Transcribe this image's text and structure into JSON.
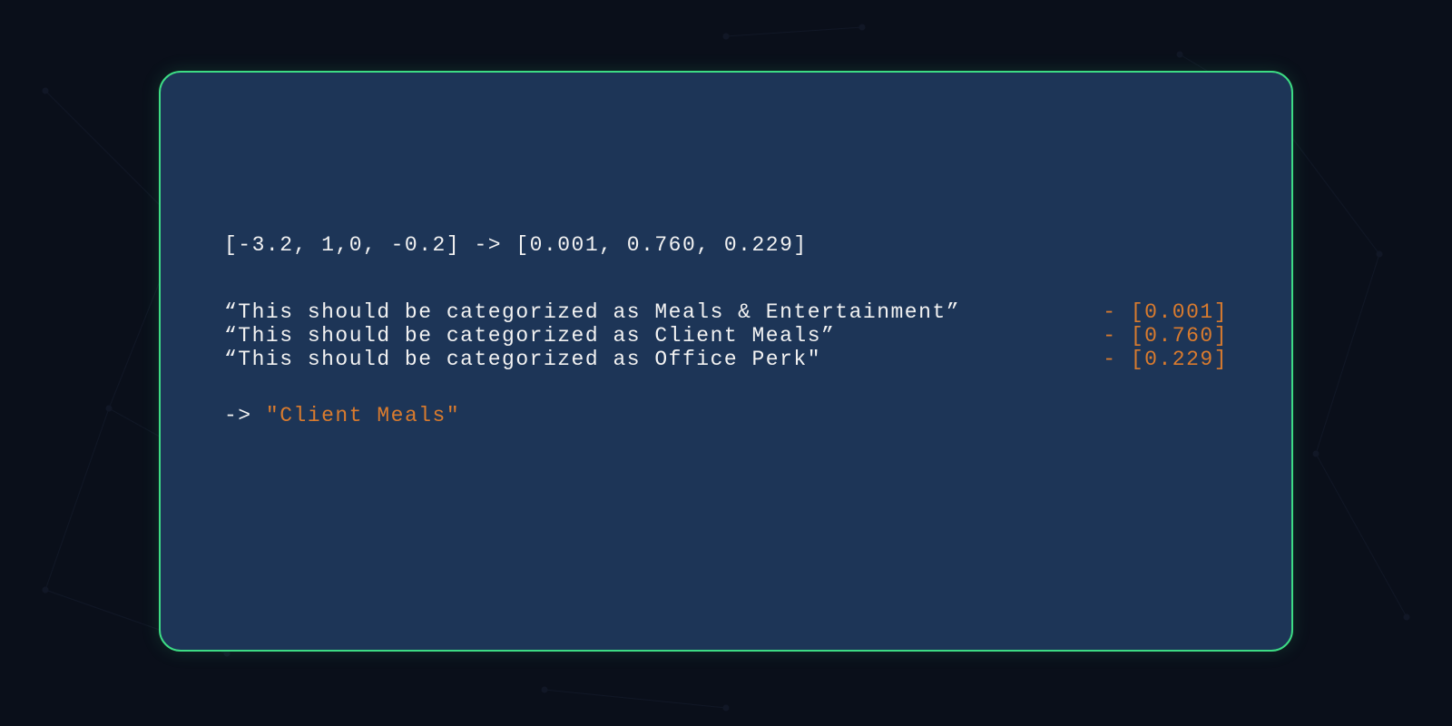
{
  "vector_line": "[-3.2, 1,0, -0.2] -> [0.001, 0.760, 0.229]",
  "rows": [
    {
      "text": "“This should be categorized as Meals & Entertainment”",
      "dash": " - ",
      "value": "[0.001]"
    },
    {
      "text": "“This should be categorized as Client Meals”",
      "dash": " - ",
      "value": "[0.760]"
    },
    {
      "text": "“This should be categorized as Office Perk\"",
      "dash": " - ",
      "value": "[0.229]"
    }
  ],
  "result": {
    "arrow": "-> ",
    "value": "\"Client Meals\""
  }
}
